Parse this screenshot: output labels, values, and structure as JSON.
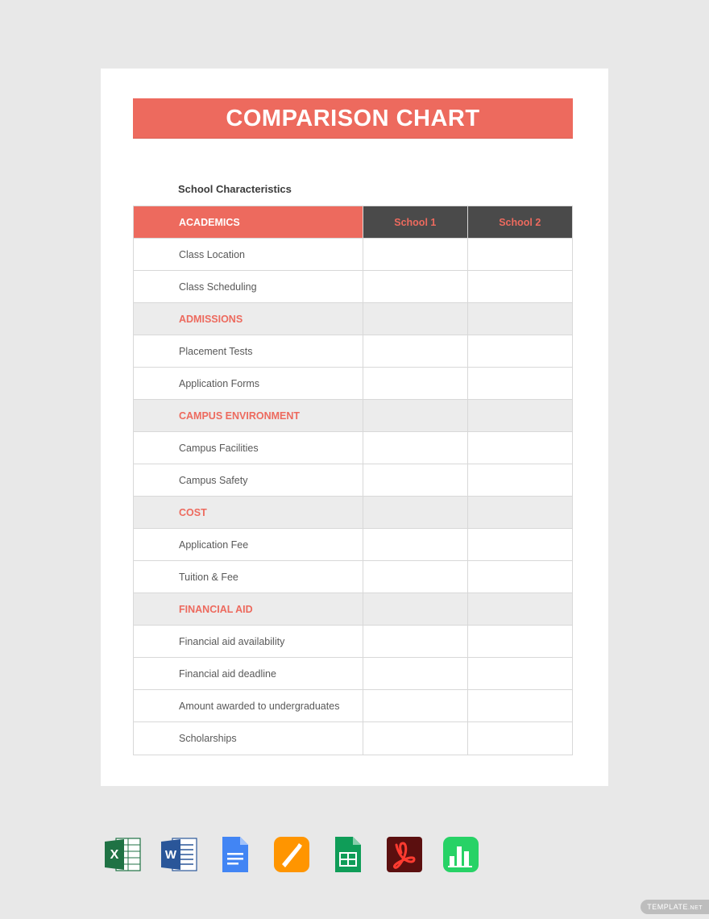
{
  "title": "COMPARISON CHART",
  "subtitle": "School Characteristics",
  "headers": {
    "col1": "ACADEMICS",
    "col2": "School 1",
    "col3": "School 2"
  },
  "sections": [
    {
      "label": "ACADEMICS",
      "isHeader": true,
      "rows": [
        {
          "label": "Class Location",
          "s1": "",
          "s2": ""
        },
        {
          "label": "Class Scheduling",
          "s1": "",
          "s2": ""
        }
      ]
    },
    {
      "label": "ADMISSIONS",
      "rows": [
        {
          "label": "Placement Tests",
          "s1": "",
          "s2": ""
        },
        {
          "label": "Application Forms",
          "s1": "",
          "s2": ""
        }
      ]
    },
    {
      "label": "CAMPUS ENVIRONMENT",
      "rows": [
        {
          "label": "Campus Facilities",
          "s1": "",
          "s2": ""
        },
        {
          "label": "Campus Safety",
          "s1": "",
          "s2": ""
        }
      ]
    },
    {
      "label": "COST",
      "rows": [
        {
          "label": "Application Fee",
          "s1": "",
          "s2": ""
        },
        {
          "label": "Tuition & Fee",
          "s1": "",
          "s2": ""
        }
      ]
    },
    {
      "label": "FINANCIAL AID",
      "rows": [
        {
          "label": "Financial aid availability",
          "s1": "",
          "s2": ""
        },
        {
          "label": "Financial aid deadline",
          "s1": "",
          "s2": ""
        },
        {
          "label": "Amount awarded to undergraduates",
          "s1": "",
          "s2": ""
        },
        {
          "label": "Scholarships",
          "s1": "",
          "s2": ""
        }
      ]
    }
  ],
  "apps": [
    {
      "name": "excel-icon"
    },
    {
      "name": "word-icon"
    },
    {
      "name": "google-docs-icon"
    },
    {
      "name": "apple-pages-icon"
    },
    {
      "name": "google-sheets-icon"
    },
    {
      "name": "adobe-pdf-icon"
    },
    {
      "name": "apple-numbers-icon"
    }
  ],
  "badge": {
    "main": "TEMPLATE",
    "sub": ".NET"
  }
}
